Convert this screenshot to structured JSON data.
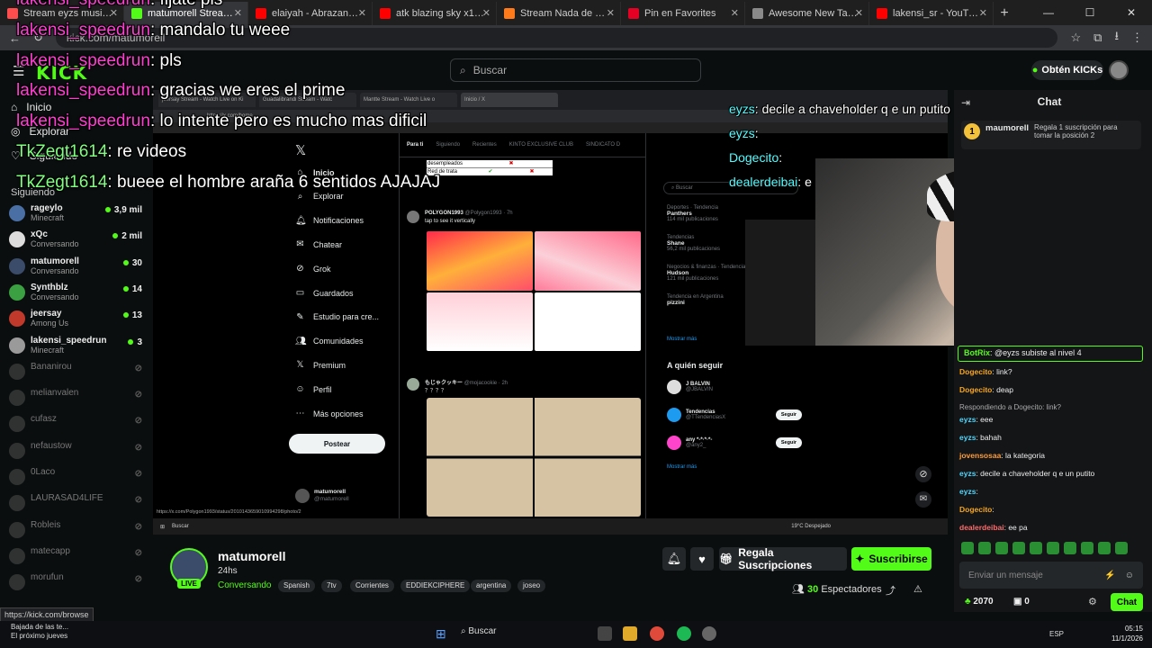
{
  "browser": {
    "tabs": [
      {
        "title": "Stream eyzs music | Listen",
        "color": "#ff4d4d",
        "active": false
      },
      {
        "title": "matumorell Stream - Watch",
        "color": "#53fc18",
        "active": true
      },
      {
        "title": "elaiyah - Abrazando La Sombra",
        "color": "#ff0000",
        "active": false
      },
      {
        "title": "atk blazing sky x1 fortnite",
        "color": "#ff0000",
        "active": false
      },
      {
        "title": "Stream Nada de Vos ,eyzs",
        "color": "#ff7a1a",
        "active": false
      },
      {
        "title": "Pin en Favorites",
        "color": "#e60023",
        "active": false
      },
      {
        "title": "Awesome New Tab Page",
        "color": "#8a8a8a",
        "active": false
      },
      {
        "title": "lakensi_sr - YouTube",
        "color": "#ff0000",
        "active": false
      }
    ],
    "url": "kick.com/matumorell"
  },
  "header": {
    "search_placeholder": "Buscar",
    "get_kicks": "Obtén KICKs",
    "logo": "KICK"
  },
  "sidebar": {
    "nav": [
      {
        "label": "Inicio",
        "icon": "home-icon"
      },
      {
        "label": "Explorar",
        "icon": "compass-icon"
      },
      {
        "label": "Siguiendo",
        "icon": "heart-icon"
      }
    ],
    "following_title": "Siguiendo",
    "following": [
      {
        "name": "rageylo",
        "sub": "Minecraft",
        "count": "3,9 mil",
        "live": true,
        "color": "#4a6fa5"
      },
      {
        "name": "xQc",
        "sub": "Conversando",
        "count": "2 mil",
        "live": true,
        "color": "#dddddd"
      },
      {
        "name": "matumorell",
        "sub": "Conversando",
        "count": "30",
        "live": true,
        "color": "#3a4c6a"
      },
      {
        "name": "Synthblz",
        "sub": "Conversando",
        "count": "14",
        "live": true,
        "color": "#3aa041"
      },
      {
        "name": "jeersay",
        "sub": "Among Us",
        "count": "13",
        "live": true,
        "color": "#c0392b"
      },
      {
        "name": "lakensi_speedrun",
        "sub": "Minecraft",
        "count": "3",
        "live": true,
        "color": "#9a9a9a"
      },
      {
        "name": "Bananirou",
        "sub": "",
        "count": "",
        "live": false,
        "color": "#555"
      },
      {
        "name": "melianvalen",
        "sub": "",
        "count": "",
        "live": false,
        "color": "#555"
      },
      {
        "name": "cufasz",
        "sub": "",
        "count": "",
        "live": false,
        "color": "#555"
      },
      {
        "name": "nefaustow",
        "sub": "",
        "count": "",
        "live": false,
        "color": "#555"
      },
      {
        "name": "0Laco",
        "sub": "",
        "count": "",
        "live": false,
        "color": "#555"
      },
      {
        "name": "LAURASAD4LIFE",
        "sub": "",
        "count": "",
        "live": false,
        "color": "#555"
      },
      {
        "name": "Robleis",
        "sub": "",
        "count": "",
        "live": false,
        "color": "#555"
      },
      {
        "name": "matecapp",
        "sub": "",
        "count": "",
        "live": false,
        "color": "#555"
      },
      {
        "name": "morufun",
        "sub": "",
        "count": "",
        "live": false,
        "color": "#555"
      }
    ]
  },
  "overlay_chat": [
    {
      "user": "lakensi_speedrun",
      "msg": "fijate pls"
    },
    {
      "user": "lakensi_speedrun",
      "msg": "mandalo tu weee"
    },
    {
      "user": "lakensi_speedrun",
      "msg": "pls"
    },
    {
      "user": "lakensi_speedrun",
      "msg": "gracias we eres el prime"
    },
    {
      "user": "lakensi_speedrun",
      "msg": "lo intente pero es mucho mas dificil"
    },
    {
      "user": "TkZegt1614",
      "msg": "re videos"
    },
    {
      "user": "TkZegt1614",
      "msg": "bueee el hombre araña 6 sentidos AJAJAJ"
    }
  ],
  "stream_overlay": [
    {
      "user": "eyzs",
      "msg": "decile a chaveholder q e un putito"
    },
    {
      "user": "eyzs",
      "msg": ""
    },
    {
      "user": "Dogecito",
      "msg": ""
    },
    {
      "user": "dealerdeibai",
      "msg": "e"
    }
  ],
  "inner_screen": {
    "tabs": [
      "jeersay Stream - Watch Live on Ki",
      "Guadalibrandi Stream - Watc",
      "Mantte Stream - Watch Live o",
      "Inicio / X"
    ],
    "url": "https://x.com/home",
    "nav": [
      "Inicio",
      "Explorar",
      "Notificaciones",
      "Chatear",
      "Grok",
      "Guardados",
      "Estudio para cre...",
      "Comunidades",
      "Premium",
      "Perfil",
      "Más opciones"
    ],
    "nav_icons": [
      "home-icon",
      "search-icon",
      "bell-icon",
      "chat-icon",
      "grok-icon",
      "bookmark-icon",
      "studio-icon",
      "community-icon",
      "x-icon",
      "person-icon",
      "more-icon"
    ],
    "post_button": "Postear",
    "profile_name": "matumorell",
    "profile_handle": "@matumorell",
    "feed_tabs": [
      "Para ti",
      "Siguiendo",
      "Recientes",
      "KINTO EXCLUSIVE CLUB",
      "SINDICATO D"
    ],
    "tweet1_user": "POLYGON1993",
    "tweet1_handle": "@Polygon1993 · 7h",
    "tweet1_text": "tap to see it vertically",
    "tweet2_user": "もじゃクッキー",
    "tweet2_handle": "@mojacookie · 2h",
    "tweet2_text": "？？？？",
    "table_rows": [
      "desempleados",
      "Red de trata"
    ],
    "search_placeholder": "Buscar",
    "trends": [
      {
        "meta": "Deportes · Tendencia",
        "name": "Panthers",
        "posts": "114 mil publicaciones"
      },
      {
        "meta": "Tendencias",
        "name": "Shane",
        "posts": "56,2 mil publicaciones"
      },
      {
        "meta": "Negocios & finanzas · Tendencia",
        "name": "Hudson",
        "posts": "121 mil publicaciones"
      },
      {
        "meta": "Tendencia en Argentina",
        "name": "pizzini",
        "posts": ""
      }
    ],
    "show_more": "Mostrar más",
    "who_to_follow": "A quién seguir",
    "follow_suggestions": [
      {
        "name": "J BALVIN",
        "handle": "@JBALVIN",
        "button": ""
      },
      {
        "name": "Tendencias",
        "handle": "@TTendenciasX",
        "button": "Seguir"
      },
      {
        "name": "any *-*·*·*-",
        "handle": "@any2_",
        "button": "Seguir"
      }
    ],
    "status_url": "https://x.com/Polygon1993/status/2010143659010994298/photo/2",
    "taskbar_search": "Buscar",
    "weather": "19°C Despejado"
  },
  "stream_info": {
    "name": "matumorell",
    "duration": "24hs",
    "category": "Conversando",
    "live_label": "LIVE",
    "tags": [
      "Spanish",
      "7tv",
      "Corrientes",
      "EDDIEKCIPHERE",
      "argentina",
      "joseo"
    ],
    "gift_label": "Regala Suscripciones",
    "subscribe_label": "Suscribirse",
    "viewers_count": "30",
    "viewers_label": "Espectadores"
  },
  "chat": {
    "title": "Chat",
    "pinned_user": "maumorell",
    "pinned_text": "Regala 1 suscripción para tomar la posición 2",
    "bot_user": "BotRix",
    "bot_text": ": @eyzs subiste al nivel 4",
    "messages": [
      {
        "user": "Dogecito",
        "color": "#f5a623",
        "text": ": link?"
      },
      {
        "user": "Dogecito",
        "color": "#f5a623",
        "text": ": deap"
      },
      {
        "reply": "Respondiendo a Dogecito: link?"
      },
      {
        "user": "eyzs",
        "color": "#53d6fc",
        "text": ": eee"
      },
      {
        "user": "eyzs",
        "color": "#53d6fc",
        "text": ": bahah"
      },
      {
        "user": "jovensosaa",
        "color": "#ff9d3b",
        "text": ": la kategoria"
      },
      {
        "user": "eyzs",
        "color": "#53d6fc",
        "text": ": decile a chaveholder q e un putito"
      },
      {
        "user": "eyzs",
        "color": "#53d6fc",
        "text": ":"
      },
      {
        "user": "Dogecito",
        "color": "#f5a623",
        "text": ":"
      },
      {
        "user": "dealerdeibai",
        "color": "#ff6b6b",
        "text": ": ee pa"
      }
    ],
    "input_placeholder": "Enviar un mensaje",
    "points": "2070",
    "points2": "0",
    "send_label": "Chat"
  },
  "status_bar_url": "https://kick.com/browse",
  "os_taskbar": {
    "notice_line1": "Bajada de las te...",
    "notice_line2": "El próximo jueves",
    "search": "Buscar",
    "lang": "ESP",
    "time": "05:15",
    "date": "11/1/2026"
  }
}
